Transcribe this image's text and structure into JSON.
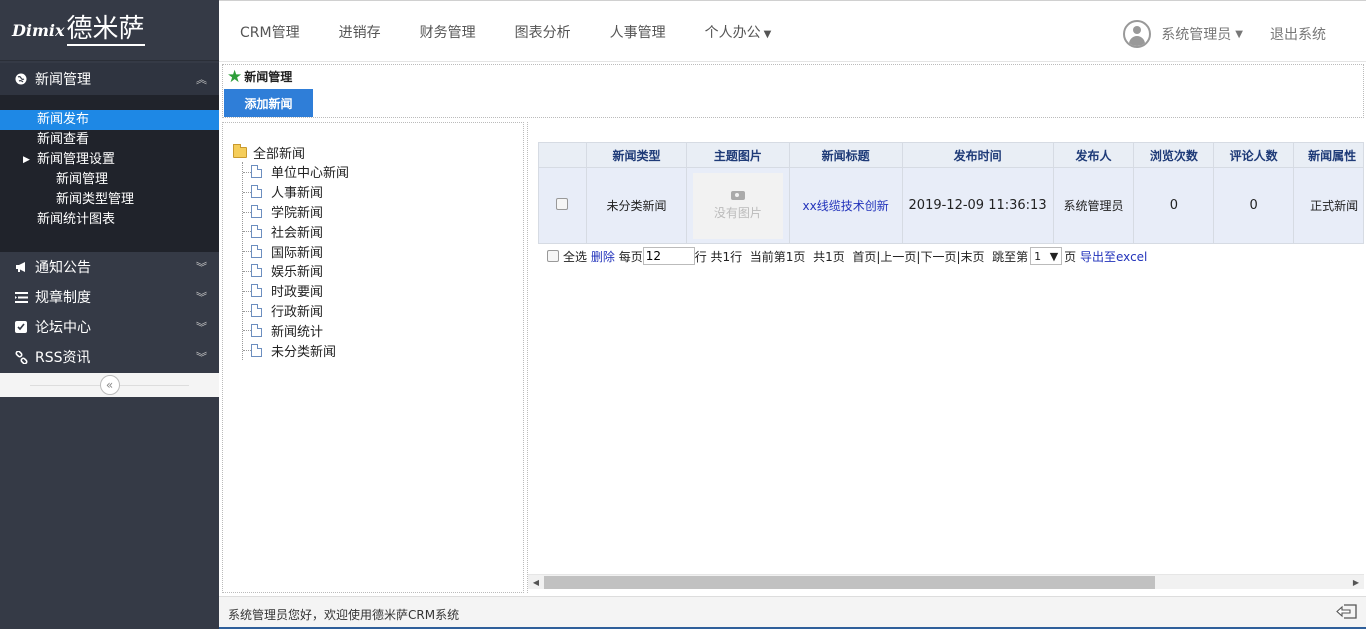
{
  "brand": {
    "logo_en": "Dimix",
    "logo_cn": "德米萨"
  },
  "sidebar": {
    "sections": [
      {
        "label": "新闻管理",
        "icon": "globe-icon",
        "chevron": "︽"
      },
      {
        "label": "通知公告",
        "icon": "megaphone-icon",
        "chevron": "︾"
      },
      {
        "label": "规章制度",
        "icon": "list-icon",
        "chevron": "︾"
      },
      {
        "label": "论坛中心",
        "icon": "checkbox-icon",
        "chevron": "︾"
      },
      {
        "label": "RSS资讯",
        "icon": "link-icon",
        "chevron": "︾"
      }
    ],
    "news_sub": [
      {
        "label": "新闻发布"
      },
      {
        "label": "新闻查看"
      },
      {
        "label": "新闻管理设置"
      },
      {
        "label": "新闻管理"
      },
      {
        "label": "新闻类型管理"
      },
      {
        "label": "新闻统计图表"
      }
    ],
    "collapse_label": "«"
  },
  "topnav": {
    "items": [
      "CRM管理",
      "进销存",
      "财务管理",
      "图表分析",
      "人事管理",
      "个人办公"
    ],
    "user": "系统管理员",
    "logout": "退出系统"
  },
  "toolbar": {
    "title": "新闻管理",
    "add_button": "添加新闻"
  },
  "tree": {
    "root": "全部新闻",
    "nodes": [
      "单位中心新闻",
      "人事新闻",
      "学院新闻",
      "社会新闻",
      "国际新闻",
      "娱乐新闻",
      "时政要闻",
      "行政新闻",
      "新闻统计",
      "未分类新闻"
    ]
  },
  "grid": {
    "columns": [
      "新闻类型",
      "主题图片",
      "新闻标题",
      "发布时间",
      "发布人",
      "浏览次数",
      "评论人数",
      "新闻属性"
    ],
    "rows": [
      {
        "type": "未分类新闻",
        "image_placeholder": "没有图片",
        "title": "xx线缆技术创新",
        "time": "2019-12-09 11:36:13",
        "publisher": "系统管理员",
        "views": "0",
        "comments": "0",
        "attribute": "正式新闻"
      }
    ]
  },
  "pager": {
    "select_all": "全选",
    "delete": "删除",
    "per_page_label": "每页",
    "per_page_value": "12",
    "total_rows": "行 共1行",
    "current_page": "当前第1页",
    "total_pages": "共1页",
    "nav": "首页|上一页|下一页|末页",
    "jump_label": "跳至第",
    "jump_value": "1",
    "page_suffix": "页",
    "export": "导出至excel"
  },
  "footer": {
    "welcome": "系统管理员您好，欢迎使用德米萨CRM系统"
  },
  "colors": {
    "sidebar_bg": "#353a46",
    "selected_blue": "#1e88e5",
    "button_blue": "#2f7ed8"
  }
}
